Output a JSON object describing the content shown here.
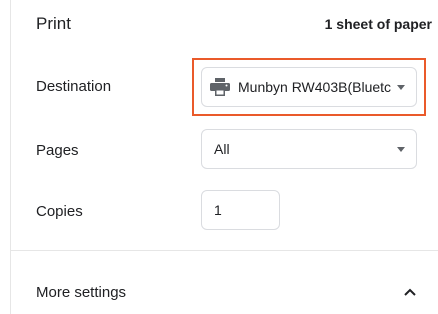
{
  "header": {
    "title": "Print",
    "sheet_count": "1 sheet of paper"
  },
  "destination": {
    "label": "Destination",
    "value": "Munbyn RW403B(Bluetc",
    "icon": "printer-icon",
    "highlight_color": "#ea5a2a"
  },
  "pages": {
    "label": "Pages",
    "value": "All"
  },
  "copies": {
    "label": "Copies",
    "value": "1"
  },
  "more_settings": {
    "label": "More settings",
    "icon": "chevron-up-icon"
  }
}
